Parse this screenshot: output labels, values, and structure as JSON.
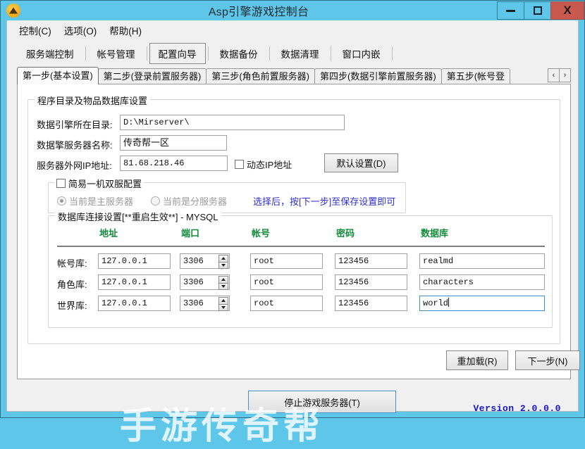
{
  "window": {
    "title": "Asp引擎游戏控制台",
    "icon": "warning-triangle-icon",
    "buttons": {
      "minimize": "–",
      "maximize": "□",
      "close": "X"
    }
  },
  "menubar": {
    "items": [
      {
        "label": "控制(C)"
      },
      {
        "label": "选项(O)"
      },
      {
        "label": "帮助(H)"
      }
    ]
  },
  "navbar": {
    "items": [
      {
        "label": "服务端控制",
        "active": false
      },
      {
        "label": "帐号管理",
        "active": false
      },
      {
        "label": "配置向导",
        "active": true
      },
      {
        "label": "数据备份",
        "active": false
      },
      {
        "label": "数据清理",
        "active": false
      },
      {
        "label": "窗口内嵌",
        "active": false
      }
    ]
  },
  "tabs": {
    "items": [
      {
        "label": "第一步(基本设置)",
        "selected": true
      },
      {
        "label": "第二步(登录前置服务器)",
        "selected": false
      },
      {
        "label": "第三步(角色前置服务器)",
        "selected": false
      },
      {
        "label": "第四步(数据引擎前置服务器)",
        "selected": false
      },
      {
        "label": "第五步(帐号登",
        "selected": false
      }
    ],
    "scroll_prev": "‹",
    "scroll_next": "›"
  },
  "main_group": {
    "title": "程序目录及物品数据库设置",
    "fields": {
      "dir_label": "数据引擎所在目录:",
      "dir_value": "D:\\Mirserver\\",
      "server_name_label": "数据擎服务器名称:",
      "server_name_value": "传奇帮一区",
      "wan_ip_label": "服务器外网IP地址:",
      "wan_ip_value": "81.68.218.46",
      "dynamic_ip_label": "动态IP地址",
      "dynamic_ip_checked": false,
      "default_btn": "默认设置(D)",
      "default_btn_text": "默认设置",
      "default_btn_key": "D"
    },
    "dual_group": {
      "title": "简易一机双服配置",
      "checked": false,
      "radio_main": "当前是主服务器",
      "radio_sub": "当前是分服务器",
      "radio_selected": "当前是主服务器",
      "hint": "选择后，按[下一步]至保存设置即可"
    },
    "db_group": {
      "title": "数据库连接设置[**重启生效**] - MYSQL",
      "columns": [
        "地址",
        "端口",
        "帐号",
        "密码",
        "数据库"
      ],
      "rows": [
        {
          "label": "帐号库:",
          "address": "127.0.0.1",
          "port": "3306",
          "account": "root",
          "password": "123456",
          "database": "realmd",
          "focused": false
        },
        {
          "label": "角色库:",
          "address": "127.0.0.1",
          "port": "3306",
          "account": "root",
          "password": "123456",
          "database": "characters",
          "focused": false
        },
        {
          "label": "世界库:",
          "address": "127.0.0.1",
          "port": "3306",
          "account": "root",
          "password": "123456",
          "database": "world",
          "focused": true
        }
      ]
    },
    "actions": {
      "reload": "重加载(R)",
      "reload_text": "重加载",
      "reload_key": "R",
      "next": "下一步(N)",
      "next_text": "下一步",
      "next_key": "N"
    }
  },
  "bottom": {
    "stop_button": "停止游戏服务器(T)",
    "stop_button_text": "停止游戏服务器",
    "stop_button_key": "T",
    "version": "Version 2.0.0.0",
    "watermark": "手游传奇帮"
  },
  "colors": {
    "titlebar": "#5ec6e8",
    "close_button": "#c9584f",
    "column_header": "#138a3c",
    "hint_text": "#2f2fcf",
    "version_text": "#1414cc",
    "focus_border": "#3c8ecf"
  }
}
